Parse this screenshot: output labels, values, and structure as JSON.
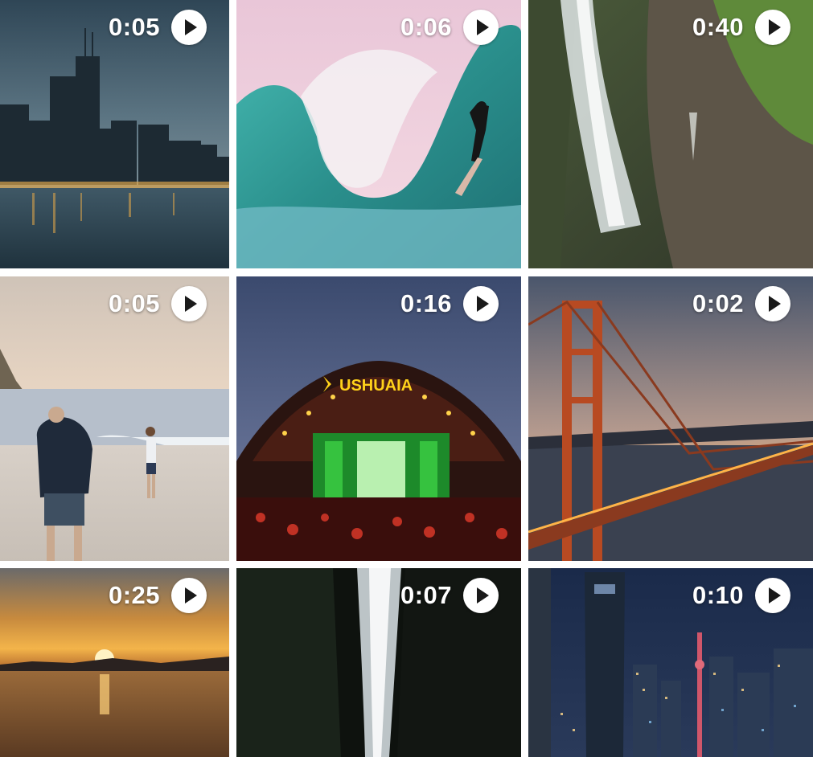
{
  "gallery": {
    "videos": [
      {
        "subject": "city-skyline",
        "duration": "0:05",
        "play_icon": "play-icon"
      },
      {
        "subject": "surf-wave",
        "duration": "0:06",
        "play_icon": "play-icon"
      },
      {
        "subject": "waterfall-cliff",
        "duration": "0:40",
        "play_icon": "play-icon"
      },
      {
        "subject": "beach-walk",
        "duration": "0:05",
        "play_icon": "play-icon"
      },
      {
        "subject": "concert-stage",
        "duration": "0:16",
        "play_icon": "play-icon",
        "stage_sign": "USHUAIA"
      },
      {
        "subject": "golden-gate-bridge",
        "duration": "0:02",
        "play_icon": "play-icon"
      },
      {
        "subject": "sunset-bay",
        "duration": "0:25",
        "play_icon": "play-icon"
      },
      {
        "subject": "waterfall-night",
        "duration": "0:07",
        "play_icon": "play-icon"
      },
      {
        "subject": "city-night-tower",
        "duration": "0:10",
        "play_icon": "play-icon"
      }
    ]
  },
  "colors": {
    "overlay_text": "#ffffff",
    "play_button_bg": "#ffffff",
    "play_glyph": "#1a1a1a",
    "grid_gap": "#ffffff"
  }
}
